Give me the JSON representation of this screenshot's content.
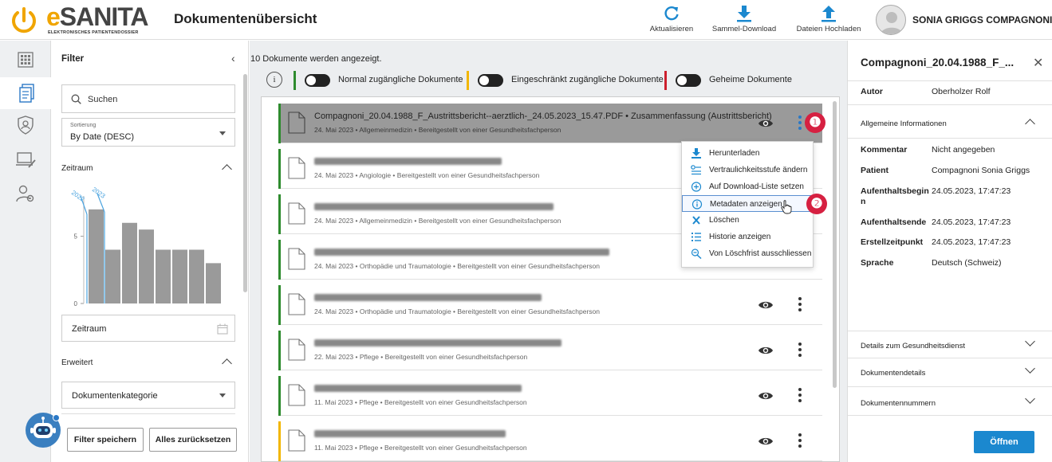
{
  "header": {
    "logo_word": "SANITA",
    "logo_letter": "e",
    "logo_sub": "ELEKTRONISCHES PATIENTENDOSSIER",
    "title": "Dokumentenübersicht",
    "actions": [
      {
        "label": "Aktualisieren",
        "icon": "refresh-icon"
      },
      {
        "label": "Sammel-Download",
        "icon": "download-icon"
      },
      {
        "label": "Dateien Hochladen",
        "icon": "upload-icon"
      }
    ],
    "user_name": "SONIA GRIGGS COMPAGNONI"
  },
  "rail": {
    "items": [
      "grid-icon",
      "documents-icon",
      "shield-user-icon",
      "laptop-edit-icon",
      "user-settings-icon"
    ]
  },
  "filter": {
    "title": "Filter",
    "search_placeholder": "Suchen",
    "sort_label": "Sortierung",
    "sort_value": "By Date (DESC)",
    "zeitraum_label": "Zeitraum",
    "zeitraum_field": "Zeitraum",
    "erweitert_label": "Erweitert",
    "kategorie_field": "Dokumentenkategorie",
    "save_button": "Filter speichern",
    "reset_button": "Alles zurücksetzen"
  },
  "chart_data": {
    "type": "bar",
    "year_labels": [
      "2022",
      "2023"
    ],
    "values": [
      7,
      4,
      6,
      5.5,
      4,
      4,
      4,
      3
    ],
    "yticks": [
      "0",
      "5"
    ],
    "ylim": [
      0,
      8
    ]
  },
  "main": {
    "count_text": "10 Dokumente werden angezeigt.",
    "toggles": [
      {
        "label": "Normal zugängliche Dokumente",
        "color": "#2e8b2e"
      },
      {
        "label": "Eingeschränkt zugängliche Dokumente",
        "color": "#f2b600"
      },
      {
        "label": "Geheime Dokumente",
        "color": "#cc1f2d"
      }
    ],
    "documents": [
      {
        "title": "Compagnoni_20.04.1988_F_Austrittsbericht--aerztlich-_24.05.2023_15.47.PDF • Zusammenfassung (Austrittsbericht)",
        "meta": "24. Mai 2023 • Allgemeinmedizin • Bereitgestellt von einer Gesundheitsfachperson",
        "stripe": "#2e8b2e",
        "selected": true,
        "show_actions": true
      },
      {
        "title": "",
        "meta": "24. Mai 2023 • Angiologie • Bereitgestellt von einer Gesundheitsfachperson",
        "stripe": "#2e8b2e",
        "selected": false,
        "show_actions": false
      },
      {
        "title": "",
        "meta": "24. Mai 2023 • Allgemeinmedizin • Bereitgestellt von einer Gesundheitsfachperson",
        "stripe": "#2e8b2e",
        "selected": false,
        "show_actions": false
      },
      {
        "title": "",
        "meta": "24. Mai 2023 • Orthopädie und Traumatologie • Bereitgestellt von einer Gesundheitsfachperson",
        "stripe": "#2e8b2e",
        "selected": false,
        "show_actions": false
      },
      {
        "title": "",
        "meta": "24. Mai 2023 • Orthopädie und Traumatologie • Bereitgestellt von einer Gesundheitsfachperson",
        "stripe": "#2e8b2e",
        "selected": false,
        "show_actions": true
      },
      {
        "title": "",
        "meta": "22. Mai 2023 • Pflege • Bereitgestellt von einer Gesundheitsfachperson",
        "stripe": "#2e8b2e",
        "selected": false,
        "show_actions": true
      },
      {
        "title": "",
        "meta": "11. Mai 2023 • Pflege • Bereitgestellt von einer Gesundheitsfachperson",
        "stripe": "#2e8b2e",
        "selected": false,
        "show_actions": true
      },
      {
        "title": "",
        "meta": "11. Mai 2023 • Pflege • Bereitgestellt von einer Gesundheitsfachperson",
        "stripe": "#f2b600",
        "selected": false,
        "show_actions": true
      }
    ]
  },
  "context_menu": {
    "items": [
      {
        "label": "Herunterladen",
        "icon": "download-icon"
      },
      {
        "label": "Vertraulichkeitsstufe ändern",
        "icon": "confidentiality-icon"
      },
      {
        "label": "Auf Download-Liste setzen",
        "icon": "add-circle-icon"
      },
      {
        "label": "Metadaten anzeigen",
        "icon": "info-icon"
      },
      {
        "label": "Löschen",
        "icon": "delete-x-icon"
      },
      {
        "label": "Historie anzeigen",
        "icon": "history-list-icon"
      },
      {
        "label": "Von Löschfrist ausschliessen",
        "icon": "exclude-deletion-icon"
      }
    ]
  },
  "badges": [
    "❶",
    "❷",
    "❸"
  ],
  "details": {
    "title": "Compagnoni_20.04.1988_F_...",
    "autor_label": "Autor",
    "autor_value": "Oberholzer Rolf",
    "general_section": "Allgemeine Informationen",
    "fields": [
      {
        "label": "Kommentar",
        "value": "Nicht angegeben"
      },
      {
        "label": "Patient",
        "value": "Compagnoni Sonia Griggs"
      },
      {
        "label": "Aufenthaltsbegin n",
        "value": "24.05.2023, 17:47:23"
      },
      {
        "label": "Aufenthaltsende",
        "value": "24.05.2023, 17:47:23"
      },
      {
        "label": "Erstellzeitpunkt",
        "value": "24.05.2023, 17:47:23"
      },
      {
        "label": "Sprache",
        "value": "Deutsch (Schweiz)"
      }
    ],
    "sections": [
      "Details zum Gesundheitsdienst",
      "Dokumentendetails",
      "Dokumentennummern"
    ],
    "open_button": "Öffnen"
  }
}
